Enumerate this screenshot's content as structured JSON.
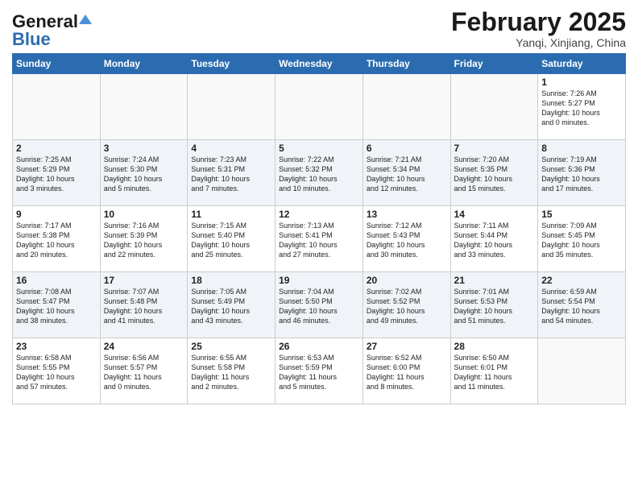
{
  "header": {
    "logo_text1": "General",
    "logo_text2": "Blue",
    "title": "February 2025",
    "subtitle": "Yanqi, Xinjiang, China"
  },
  "days_of_week": [
    "Sunday",
    "Monday",
    "Tuesday",
    "Wednesday",
    "Thursday",
    "Friday",
    "Saturday"
  ],
  "weeks": [
    [
      {
        "day": "",
        "info": ""
      },
      {
        "day": "",
        "info": ""
      },
      {
        "day": "",
        "info": ""
      },
      {
        "day": "",
        "info": ""
      },
      {
        "day": "",
        "info": ""
      },
      {
        "day": "",
        "info": ""
      },
      {
        "day": "1",
        "info": "Sunrise: 7:26 AM\nSunset: 5:27 PM\nDaylight: 10 hours\nand 0 minutes."
      }
    ],
    [
      {
        "day": "2",
        "info": "Sunrise: 7:25 AM\nSunset: 5:29 PM\nDaylight: 10 hours\nand 3 minutes."
      },
      {
        "day": "3",
        "info": "Sunrise: 7:24 AM\nSunset: 5:30 PM\nDaylight: 10 hours\nand 5 minutes."
      },
      {
        "day": "4",
        "info": "Sunrise: 7:23 AM\nSunset: 5:31 PM\nDaylight: 10 hours\nand 7 minutes."
      },
      {
        "day": "5",
        "info": "Sunrise: 7:22 AM\nSunset: 5:32 PM\nDaylight: 10 hours\nand 10 minutes."
      },
      {
        "day": "6",
        "info": "Sunrise: 7:21 AM\nSunset: 5:34 PM\nDaylight: 10 hours\nand 12 minutes."
      },
      {
        "day": "7",
        "info": "Sunrise: 7:20 AM\nSunset: 5:35 PM\nDaylight: 10 hours\nand 15 minutes."
      },
      {
        "day": "8",
        "info": "Sunrise: 7:19 AM\nSunset: 5:36 PM\nDaylight: 10 hours\nand 17 minutes."
      }
    ],
    [
      {
        "day": "9",
        "info": "Sunrise: 7:17 AM\nSunset: 5:38 PM\nDaylight: 10 hours\nand 20 minutes."
      },
      {
        "day": "10",
        "info": "Sunrise: 7:16 AM\nSunset: 5:39 PM\nDaylight: 10 hours\nand 22 minutes."
      },
      {
        "day": "11",
        "info": "Sunrise: 7:15 AM\nSunset: 5:40 PM\nDaylight: 10 hours\nand 25 minutes."
      },
      {
        "day": "12",
        "info": "Sunrise: 7:13 AM\nSunset: 5:41 PM\nDaylight: 10 hours\nand 27 minutes."
      },
      {
        "day": "13",
        "info": "Sunrise: 7:12 AM\nSunset: 5:43 PM\nDaylight: 10 hours\nand 30 minutes."
      },
      {
        "day": "14",
        "info": "Sunrise: 7:11 AM\nSunset: 5:44 PM\nDaylight: 10 hours\nand 33 minutes."
      },
      {
        "day": "15",
        "info": "Sunrise: 7:09 AM\nSunset: 5:45 PM\nDaylight: 10 hours\nand 35 minutes."
      }
    ],
    [
      {
        "day": "16",
        "info": "Sunrise: 7:08 AM\nSunset: 5:47 PM\nDaylight: 10 hours\nand 38 minutes."
      },
      {
        "day": "17",
        "info": "Sunrise: 7:07 AM\nSunset: 5:48 PM\nDaylight: 10 hours\nand 41 minutes."
      },
      {
        "day": "18",
        "info": "Sunrise: 7:05 AM\nSunset: 5:49 PM\nDaylight: 10 hours\nand 43 minutes."
      },
      {
        "day": "19",
        "info": "Sunrise: 7:04 AM\nSunset: 5:50 PM\nDaylight: 10 hours\nand 46 minutes."
      },
      {
        "day": "20",
        "info": "Sunrise: 7:02 AM\nSunset: 5:52 PM\nDaylight: 10 hours\nand 49 minutes."
      },
      {
        "day": "21",
        "info": "Sunrise: 7:01 AM\nSunset: 5:53 PM\nDaylight: 10 hours\nand 51 minutes."
      },
      {
        "day": "22",
        "info": "Sunrise: 6:59 AM\nSunset: 5:54 PM\nDaylight: 10 hours\nand 54 minutes."
      }
    ],
    [
      {
        "day": "23",
        "info": "Sunrise: 6:58 AM\nSunset: 5:55 PM\nDaylight: 10 hours\nand 57 minutes."
      },
      {
        "day": "24",
        "info": "Sunrise: 6:56 AM\nSunset: 5:57 PM\nDaylight: 11 hours\nand 0 minutes."
      },
      {
        "day": "25",
        "info": "Sunrise: 6:55 AM\nSunset: 5:58 PM\nDaylight: 11 hours\nand 2 minutes."
      },
      {
        "day": "26",
        "info": "Sunrise: 6:53 AM\nSunset: 5:59 PM\nDaylight: 11 hours\nand 5 minutes."
      },
      {
        "day": "27",
        "info": "Sunrise: 6:52 AM\nSunset: 6:00 PM\nDaylight: 11 hours\nand 8 minutes."
      },
      {
        "day": "28",
        "info": "Sunrise: 6:50 AM\nSunset: 6:01 PM\nDaylight: 11 hours\nand 11 minutes."
      },
      {
        "day": "",
        "info": ""
      }
    ]
  ]
}
